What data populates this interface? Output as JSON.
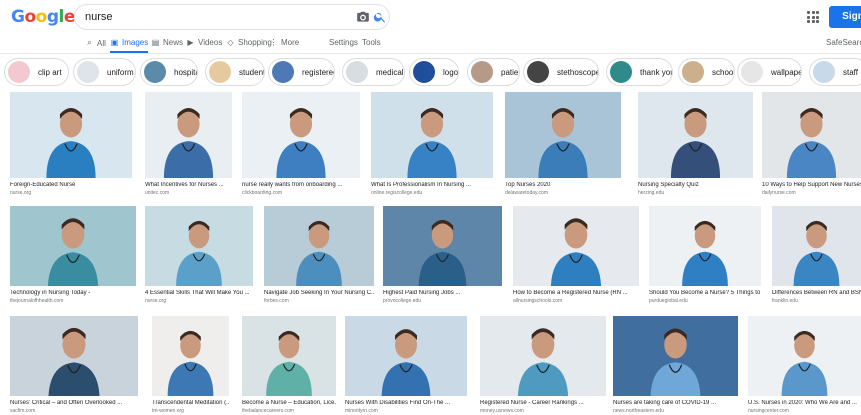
{
  "header": {
    "logo": [
      "G",
      "o",
      "o",
      "g",
      "l",
      "e"
    ],
    "logo_colors": [
      "#4285f4",
      "#ea4335",
      "#fbbc05",
      "#4285f4",
      "#34a853",
      "#ea4335"
    ],
    "search_value": "nurse",
    "camera_icon": "camera-icon",
    "search_icon": "search-icon",
    "apps_icon": "apps-grid-icon",
    "signin_label": "Sign in",
    "accent": "#1a73e8"
  },
  "tabs": {
    "all": "All",
    "images": "Images",
    "news": "News",
    "videos": "Videos",
    "shopping": "Shopping",
    "more": "More",
    "settings": "Settings",
    "tools": "Tools",
    "safesearch": "SafeSearch ▾"
  },
  "chips": [
    {
      "label": "clip art",
      "color": "#f3c9cf"
    },
    {
      "label": "uniform",
      "color": "#dfe3ea"
    },
    {
      "label": "hospital",
      "color": "#5b8ba8"
    },
    {
      "label": "student",
      "color": "#e7c9a0"
    },
    {
      "label": "registered",
      "color": "#4f79b6"
    },
    {
      "label": "medical",
      "color": "#d8dde2"
    },
    {
      "label": "logo",
      "color": "#1f4f9c"
    },
    {
      "label": "patient",
      "color": "#b59a87"
    },
    {
      "label": "stethoscope",
      "color": "#444"
    },
    {
      "label": "thank you",
      "color": "#2f8a8a"
    },
    {
      "label": "school",
      "color": "#cbb08b"
    },
    {
      "label": "wallpaper",
      "color": "#e6e6e6"
    },
    {
      "label": "staff",
      "color": "#c8d9ea"
    }
  ],
  "results": [
    {
      "title": "Foreign-Educated Nurse",
      "source": "nurse.org",
      "bg": "#d7e6ef",
      "fg": "#2a7fc0"
    },
    {
      "title": "What Incentives for Nurses ...",
      "source": "unitec.com",
      "bg": "#e9eef2",
      "fg": "#3b6ea8"
    },
    {
      "title": "nurse really wants from onboarding ...",
      "source": "clickboarding.com",
      "bg": "#eaf0f4",
      "fg": "#3d7fc1"
    },
    {
      "title": "What Is Professionalism In Nursing ...",
      "source": "online.regiscollege.edu",
      "bg": "#cfe0ea",
      "fg": "#3682c4"
    },
    {
      "title": "Top Nurses 2020",
      "source": "delawaretoday.com",
      "bg": "#a9c4d6",
      "fg": "#3a7db8"
    },
    {
      "title": "Nursing Specialty Quiz",
      "source": "herzing.edu",
      "bg": "#dfe7ee",
      "fg": "#334f7a"
    },
    {
      "title": "10 Ways to Help Support New Nurses ...",
      "source": "dailynurse.com",
      "bg": "#e2e6e8",
      "fg": "#4a86c4"
    },
    {
      "title": "Technology in Nursing Today -",
      "source": "thejournalofhhealth.com",
      "bg": "#9fc6cf",
      "fg": "#3a8da0"
    },
    {
      "title": "4 Essential Skills That Will Make You ...",
      "source": "nurse.org",
      "bg": "#c7dbe3",
      "fg": "#5aa0c8"
    },
    {
      "title": "Navigate Job Seeking In Your Nursing C...",
      "source": "forbes.com",
      "bg": "#b8ccd8",
      "fg": "#4c8fbe"
    },
    {
      "title": "Highest Paid Nursing Jobs ...",
      "source": "provocollege.edu",
      "bg": "#5e86a8",
      "fg": "#2a5f8a"
    },
    {
      "title": "How to Become a Registered Nurse (RN ...",
      "source": "allnursingschools.com",
      "bg": "#e6eaee",
      "fg": "#2e7fbf"
    },
    {
      "title": "Should You Become a Nurse? 5 Things to ...",
      "source": "purduegiobal.edu",
      "bg": "#eef1f3",
      "fg": "#2f7fc4"
    },
    {
      "title": "Differences Between RN and BSN N...",
      "source": "franklin.edu",
      "bg": "#dfe5ea",
      "fg": "#3a86c2"
    },
    {
      "title": "Nurses' Critical – and Often Overlooked ...",
      "source": "sacfim.com",
      "bg": "#c9d3dc",
      "fg": "#2b4d6e"
    },
    {
      "title": "Transcendental Meditation (...",
      "source": "tm-women.org",
      "bg": "#f0eeec",
      "fg": "#3c78b4"
    },
    {
      "title": "Become a Nurse – Education, Lice...",
      "source": "thebalancecareers.com",
      "bg": "#d9e3e6",
      "fg": "#5fb0a7"
    },
    {
      "title": "Nurses With Disabilities Find On-The ...",
      "source": "minorityrn.com",
      "bg": "#cad9e6",
      "fg": "#3471b0"
    },
    {
      "title": "Registered Nurse - Career Rankings ...",
      "source": "money.usnews.com",
      "bg": "#e3e9ec",
      "fg": "#4e9ac0"
    },
    {
      "title": "Nurses are taking care of COVID-19 ...",
      "source": "news.northeastern.edu",
      "bg": "#3f6e9f",
      "fg": "#6fa7d8"
    },
    {
      "title": "U.S. Nurses in 2020: Who We Are and ...",
      "source": "nursingcenter.com",
      "bg": "#eef1f3",
      "fg": "#5a98cc"
    }
  ]
}
